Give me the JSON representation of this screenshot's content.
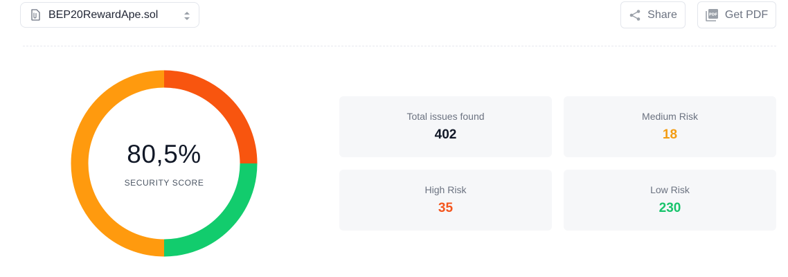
{
  "file_selector": {
    "filename": "BEP20RewardApe.sol",
    "icon": "file-icon"
  },
  "actions": {
    "share_label": "Share",
    "pdf_label": "Get PDF",
    "pdf_icon_text": "PDF"
  },
  "score": {
    "value": "80,5%",
    "label": "SECURITY SCORE",
    "chart_data": {
      "type": "pie",
      "style": "donut",
      "segments": [
        {
          "name": "high",
          "color": "#f8550f",
          "fraction": 0.25
        },
        {
          "name": "low",
          "color": "#12cc6d",
          "fraction": 0.25
        },
        {
          "name": "medium",
          "color": "#ff9a0e",
          "fraction": 0.5
        }
      ]
    }
  },
  "stats": {
    "total": {
      "label": "Total issues found",
      "value": "402",
      "color": "#111827"
    },
    "medium": {
      "label": "Medium Risk",
      "value": "18",
      "color": "#f39c12"
    },
    "high": {
      "label": "High Risk",
      "value": "35",
      "color": "#f4561e"
    },
    "low": {
      "label": "Low Risk",
      "value": "230",
      "color": "#18c46c"
    }
  }
}
